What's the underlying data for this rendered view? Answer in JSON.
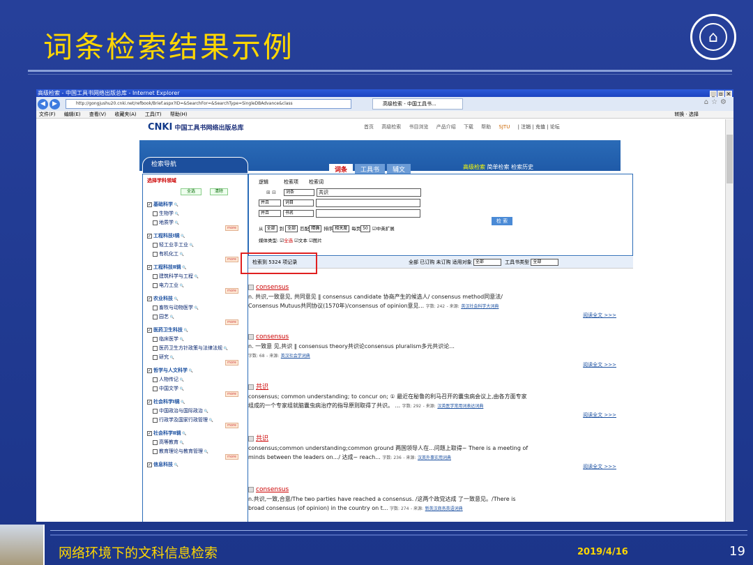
{
  "slide": {
    "title": "词条检索结果示例",
    "footer_text": "网络环境下的文科信息检索",
    "date": "2019/4/16",
    "page_number": "19"
  },
  "browser": {
    "window_title": "高级检索 - 中国工具书网络出版总库 - Internet Explorer",
    "address": "http://gongjushu20.cnki.net/refbook/Brief.aspx?ID=&SearchFor=&SearchType=SingleDBAdvance&class",
    "tab_title": "高级检索 - 中国工具书...",
    "menu": [
      "文件(F)",
      "编辑(E)",
      "查看(V)",
      "收藏夹(A)",
      "工具(T)",
      "帮助(H)"
    ],
    "menu_right": "转换 · 选择"
  },
  "site": {
    "logo_brand": "CNKI",
    "logo_text": "中国工具书网络出版总库",
    "topnav": [
      "首页",
      "高级检索",
      "书目浏览",
      "产品介绍",
      "下载",
      "帮助"
    ],
    "user": "SJTU",
    "user_links": "| 注销 | 充值 | 论坛"
  },
  "nav": {
    "head": "检索导航",
    "select_label": "选择学科领域",
    "select_all": "全选",
    "clear": "清除",
    "items": [
      {
        "label": "基础科学",
        "main": true
      },
      {
        "label": "生物学"
      },
      {
        "label": "地质学"
      },
      {
        "label": "工程科技Ⅰ辑",
        "main": true
      },
      {
        "label": "轻工业手工业"
      },
      {
        "label": "有机化工"
      },
      {
        "label": "工程科技Ⅱ辑",
        "main": true
      },
      {
        "label": "建筑科学与工程"
      },
      {
        "label": "电力工业"
      },
      {
        "label": "农业科技",
        "main": true
      },
      {
        "label": "畜牧与动物医学"
      },
      {
        "label": "园艺"
      },
      {
        "label": "医药卫生科技",
        "main": true
      },
      {
        "label": "临床医学"
      },
      {
        "label": "医药卫生方针政策与法律法规"
      },
      {
        "label": "研究"
      },
      {
        "label": "哲学与人文科学",
        "main": true
      },
      {
        "label": "人物传记"
      },
      {
        "label": "中国文学"
      },
      {
        "label": "社会科学Ⅰ辑",
        "main": true
      },
      {
        "label": "中国政治与国际政治"
      },
      {
        "label": "行政学及国家行政管理"
      },
      {
        "label": "社会科学Ⅱ辑",
        "main": true
      },
      {
        "label": "高等教育"
      },
      {
        "label": "教育理论与教育管理"
      },
      {
        "label": "信息科技",
        "main": true
      }
    ],
    "more": "more"
  },
  "tabs": [
    "词条",
    "工具书",
    "辅文"
  ],
  "tab_links": {
    "adv": "高级检索",
    "simple": "简单检索",
    "history": "检索历史"
  },
  "search": {
    "headers": [
      "逻辑",
      "检索项",
      "检索词"
    ],
    "rows": [
      {
        "logic": "",
        "field": "词条",
        "term": "共识"
      },
      {
        "logic": "并且",
        "field": "词目",
        "term": ""
      },
      {
        "logic": "并且",
        "field": "书名",
        "term": ""
      }
    ],
    "from_label": "从",
    "from_val": "全部",
    "to_label": "到",
    "to_val": "全部",
    "match_label": "匹配",
    "match_val": "精确",
    "sort_label": "排序",
    "sort_val": "相关度",
    "per_page_label": "每页",
    "per_page_val": "50",
    "expand": "中英扩展",
    "media_label": "媒体类型:",
    "media_all": "全选",
    "media_text": "文本",
    "media_image": "图片",
    "button": "检 索"
  },
  "results_bar": {
    "count": "检索到 5324 项记录",
    "tools": "全部  已订购  未订购  适用对象",
    "audience": "全部",
    "book_type_label": "工具书类型",
    "book_type": "全部"
  },
  "results": [
    {
      "title": "consensus",
      "line1": "n. 共识,一致意见, 共同意见 ‖ consensus candidate 协商产生的候选人/ consensus method同意法/",
      "line2": "Consensus Mutuus共同协议(1570年)/consensus of opinion意见...",
      "chars": "字数: 242",
      "src_label": "- 来源:",
      "source": "英汉社会科学大词典",
      "read": "阅读全文 >>>"
    },
    {
      "title": "consensus",
      "line1": "n. 一致意 见,共识 ‖ consensus theory共识论consensus pluralism多元共识论...",
      "line2": "",
      "chars": "字数: 68",
      "src_label": "- 来源:",
      "source": "英汉社会学词典",
      "read": "阅读全文 >>>"
    },
    {
      "title": "共识",
      "line1": "consensus; common understanding; to concur on; ① 最近在秘鲁的利马召开的囊虫病会议上,由各方面专家",
      "line2": "组成的一个专家组就脑囊虫病治疗的指导原则取得了共识。 ...",
      "chars": "字数: 292",
      "src_label": "- 来源:",
      "source": "汉英医学常用词表达词典",
      "read": "阅读全文 >>>"
    },
    {
      "title": "共识",
      "line1": "consensus;common understanding;common ground 两国领导人在...问题上取得~ There is a meeting of",
      "line2": "minds between the leaders on.../ 达成~ reach...",
      "chars": "字数: 236",
      "src_label": "- 来源:",
      "source": "汉英外事实用词典",
      "read": "阅读全文 >>>"
    },
    {
      "title": "consensus",
      "line1": "n.共识,一致,合意/The two parties have reached a consensus. /这两个政党达成 了一致意见。/There is",
      "line2": "broad consensus (of opinion) in the country on t...",
      "chars": "字数: 274",
      "src_label": "- 来源:",
      "source": "新英汉商务英语词典",
      "read": ""
    }
  ]
}
